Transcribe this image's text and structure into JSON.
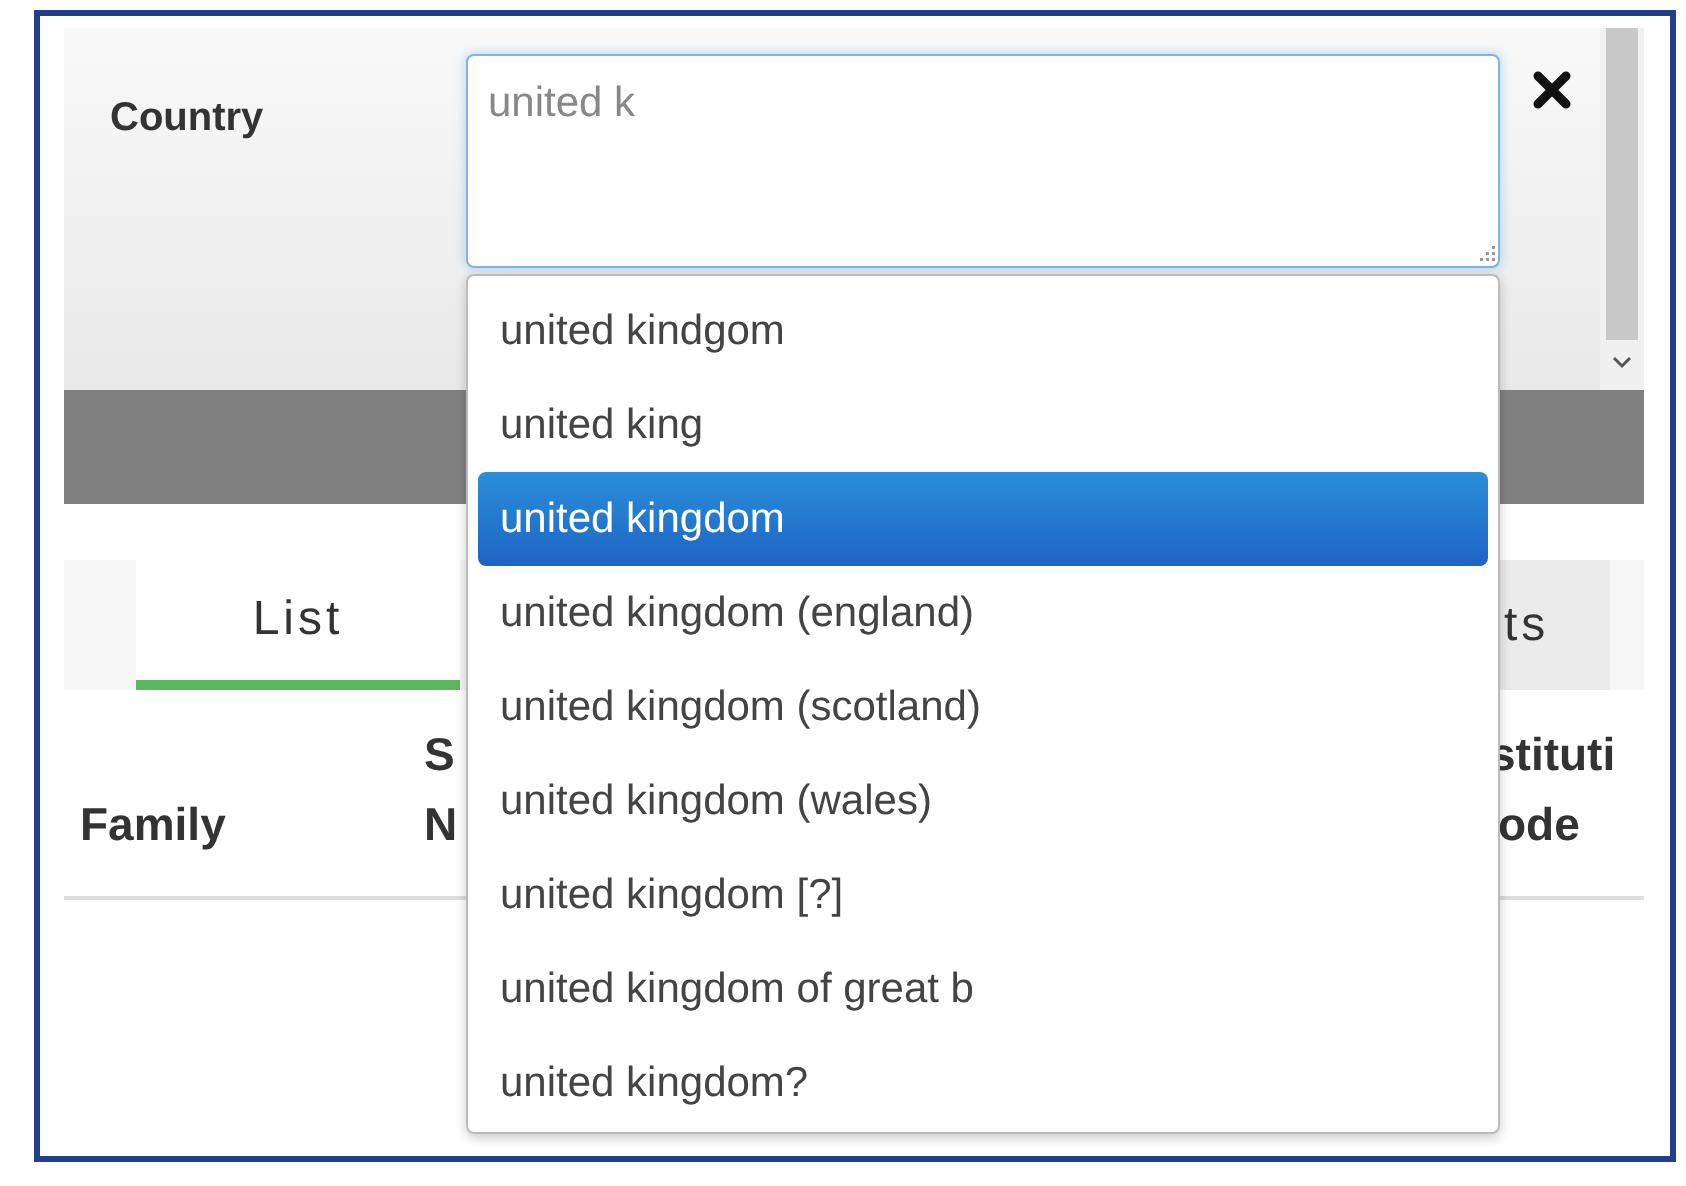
{
  "form": {
    "label": "Country",
    "value": "united k"
  },
  "suggestions": [
    {
      "label": "united kindgom",
      "selected": false
    },
    {
      "label": "united king",
      "selected": false
    },
    {
      "label": "united kingdom",
      "selected": true
    },
    {
      "label": "united kingdom (england)",
      "selected": false
    },
    {
      "label": "united kingdom (scotland)",
      "selected": false
    },
    {
      "label": "united kingdom (wales)",
      "selected": false
    },
    {
      "label": "united kingdom [?]",
      "selected": false
    },
    {
      "label": "united kingdom of great b",
      "selected": false
    },
    {
      "label": "united kingdom?",
      "selected": false
    }
  ],
  "tabs": [
    {
      "label": "List",
      "selected": true
    },
    {
      "label": "ts",
      "selected": false
    }
  ],
  "table": {
    "columns": [
      {
        "lines": [
          "Family"
        ]
      },
      {
        "lines": [
          "S",
          "N"
        ]
      },
      {
        "lines": [
          "stituti",
          "ode"
        ]
      }
    ]
  }
}
